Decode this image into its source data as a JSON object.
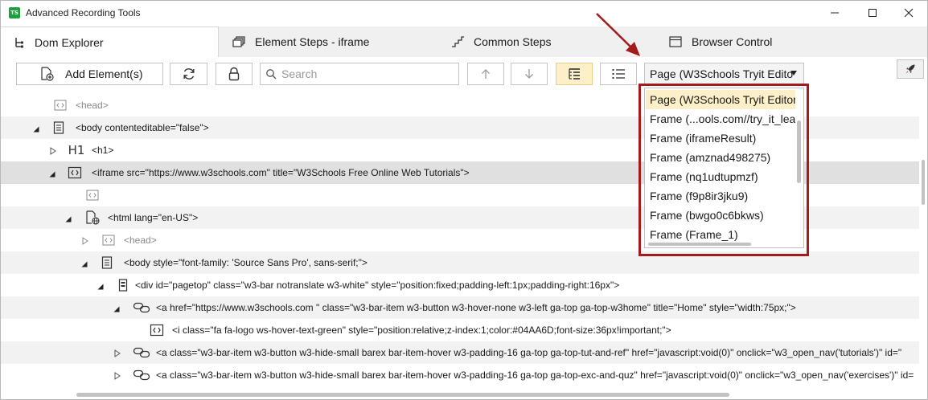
{
  "window": {
    "title": "Advanced Recording Tools",
    "logo_text": "TS"
  },
  "tabs": [
    {
      "label": "Dom Explorer"
    },
    {
      "label": "Element Steps - iframe"
    },
    {
      "label": "Common Steps"
    },
    {
      "label": "Browser Control"
    }
  ],
  "toolbar": {
    "add_element_label": "Add Element(s)",
    "search_placeholder": "Search",
    "page_select_value": "Page (W3Schools Tryit Edito"
  },
  "dropdown": {
    "options": [
      "Page (W3Schools Tryit Editor)",
      "Frame (...ools.com//try_it_leac",
      "Frame (iframeResult)",
      "Frame (amznad498275)",
      "Frame (nq1udtupmzf)",
      "Frame (f9p8ir3jku9)",
      "Frame (bwgo0c6bkws)",
      "Frame (Frame_1)"
    ],
    "highlighted_index": 0
  },
  "tree": {
    "rows": [
      {
        "text": "<head>"
      },
      {
        "text": "<body contenteditable=\"false\">"
      },
      {
        "text": "<h1>",
        "icon_text": "H1"
      },
      {
        "text": "<iframe src=\"https://www.w3schools.com\" title=\"W3Schools Free Online Web Tutorials\">"
      },
      {
        "text": ""
      },
      {
        "text": "<html lang=\"en-US\">"
      },
      {
        "text": "<head>"
      },
      {
        "text": "<body style=\"font-family: 'Source Sans Pro', sans-serif;\">"
      },
      {
        "text": "<div id=\"pagetop\" class=\"w3-bar notranslate w3-white\" style=\"position:fixed;padding-left:1px;padding-right:16px\">"
      },
      {
        "text": "<a href=\"https://www.w3schools.com \" class=\"w3-bar-item w3-button w3-hover-none w3-left ga-top ga-top-w3home\" title=\"Home\" style=\"width:75px;\">"
      },
      {
        "text": "<i class=\"fa fa-logo ws-hover-text-green\" style=\"position:relative;z-index:1;color:#04AA6D;font-size:36px!important;\">"
      },
      {
        "text": "<a class=\"w3-bar-item w3-button w3-hide-small barex bar-item-hover w3-padding-16 ga-top ga-top-tut-and-ref\" href=\"javascript:void(0)\" onclick=\"w3_open_nav('tutorials')\" id=\""
      },
      {
        "text": "<a class=\"w3-bar-item w3-button w3-hide-small barex bar-item-hover w3-padding-16 ga-top ga-top-exc-and-quz\" href=\"javascript:void(0)\" onclick=\"w3_open_nav('exercises')\" id="
      }
    ]
  },
  "colors": {
    "highlight_box": "#a31b1b",
    "toggled_bg": "#fdf0c9",
    "logo_green": "#1e9e3e"
  }
}
